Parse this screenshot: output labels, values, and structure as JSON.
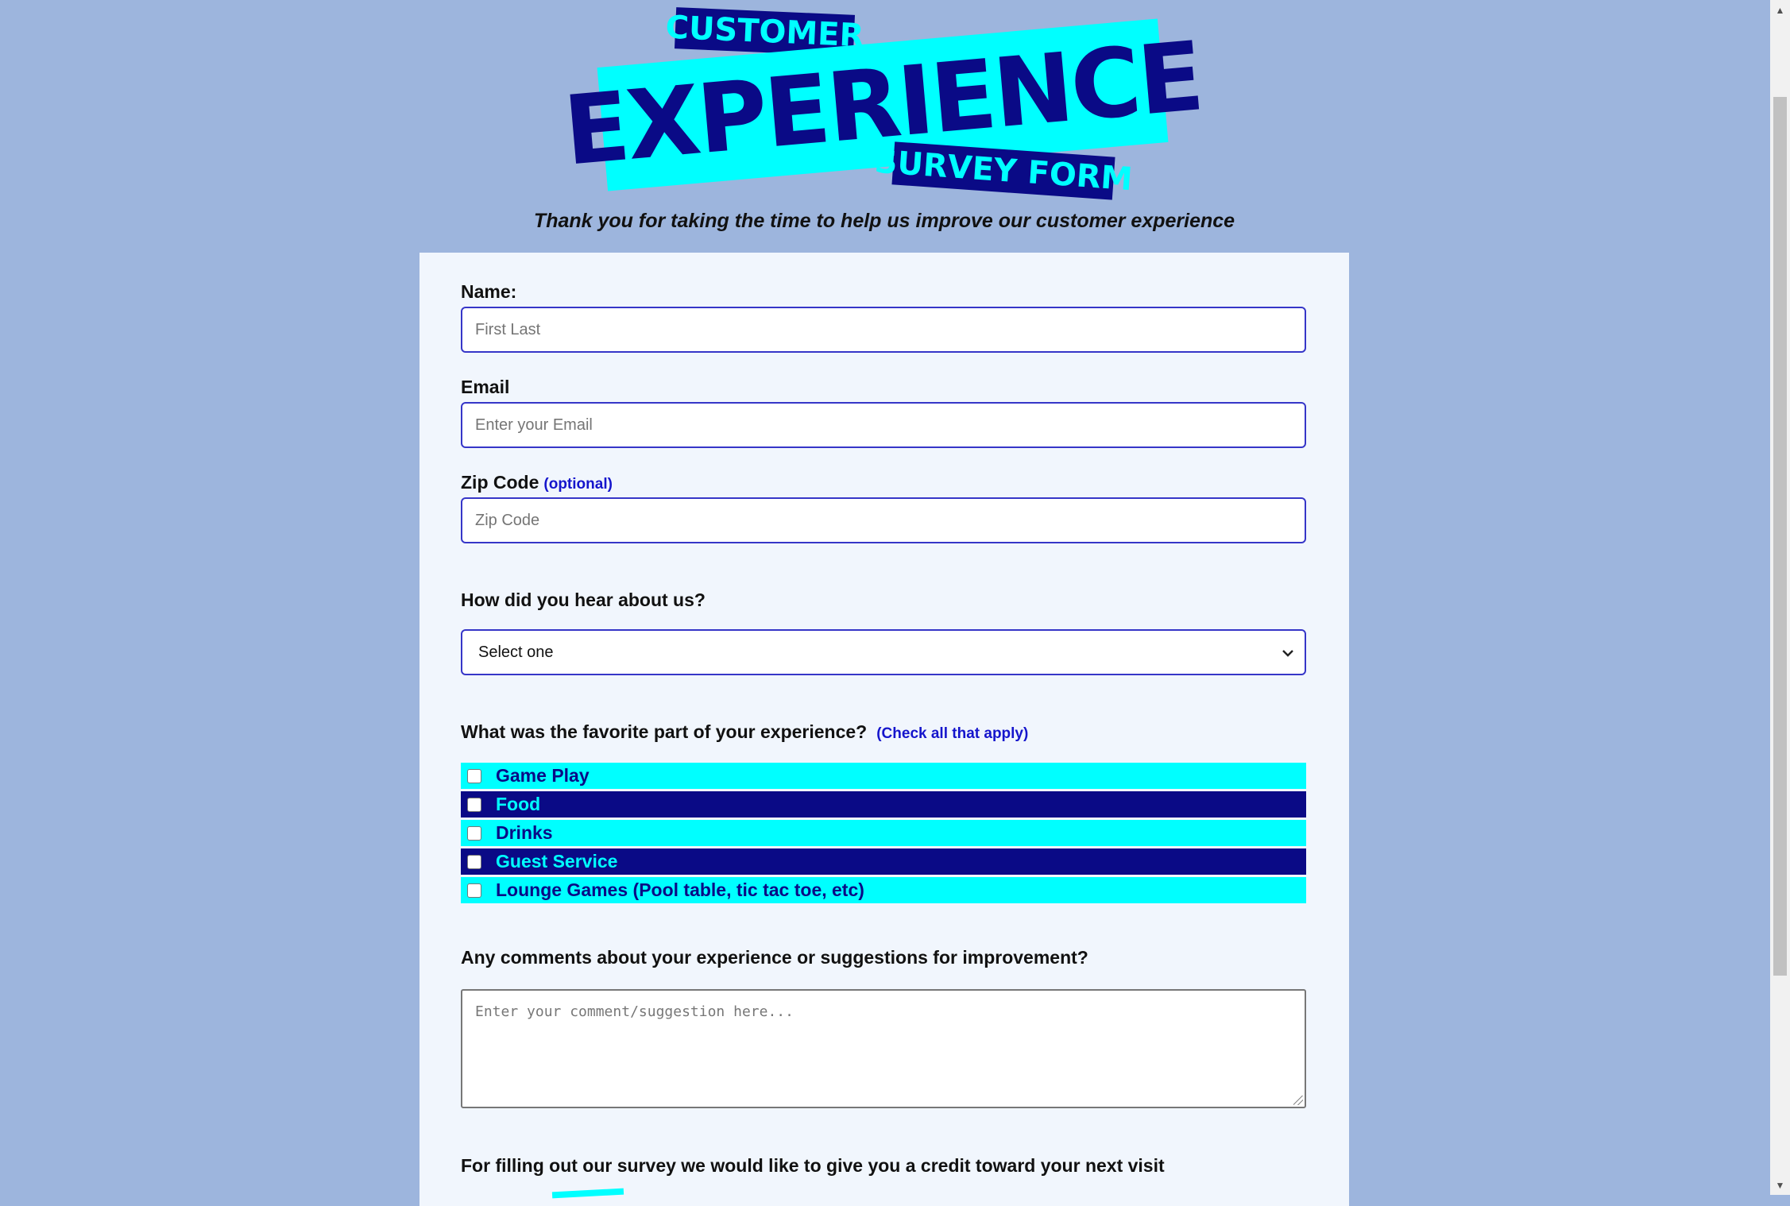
{
  "logo": {
    "line1": "CUSTOMER",
    "line2": "EXPERIENCE",
    "line3": "SURVEY FORM"
  },
  "tagline": "Thank you for taking the time to help us improve our customer experience",
  "form": {
    "name": {
      "label": "Name:",
      "placeholder": "First Last"
    },
    "email": {
      "label": "Email",
      "placeholder": "Enter your Email"
    },
    "zip": {
      "label": "Zip Code",
      "optional": "(optional)",
      "placeholder": "Zip Code"
    },
    "hear": {
      "label": "How did you hear about us?",
      "selected": "Select one"
    },
    "favorite": {
      "label": "What was the favorite part of your experience?",
      "hint": "(Check all that apply)",
      "options": [
        "Game Play",
        "Food",
        "Drinks",
        "Guest Service",
        "Lounge Games (Pool table, tic tac toe, etc)"
      ]
    },
    "comments": {
      "label": "Any comments about your experience or suggestions for improvement?",
      "placeholder": "Enter your comment/suggestion here..."
    },
    "credit": {
      "label": "For filling out our survey we would like to give you a credit toward your next visit"
    }
  },
  "colors": {
    "background": "#9db5dd",
    "cyan": "#00ffff",
    "navy": "#0a0a86",
    "card": "#f1f6fd"
  },
  "icons": {
    "select": "chevron-down-icon",
    "scroll_up": "arrow-up-icon",
    "scroll_down": "arrow-down-icon"
  }
}
